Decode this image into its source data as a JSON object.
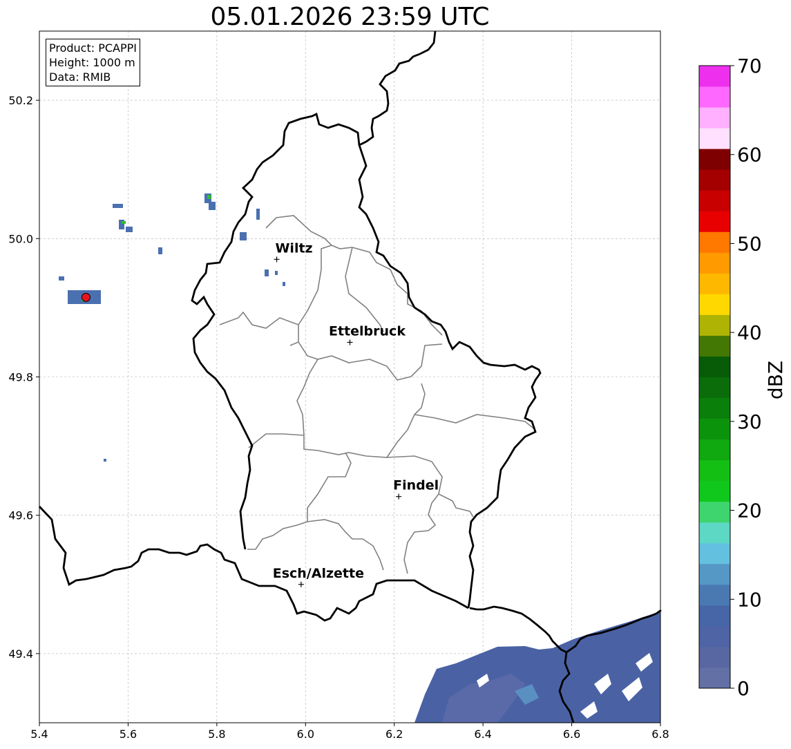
{
  "title": "05.01.2026 23:59 UTC",
  "info": {
    "product": "Product: PCAPPI",
    "height": "Height: 1000 m",
    "data": "Data: RMIB"
  },
  "axes": {
    "x_ticks": [
      "5.4",
      "5.6",
      "5.8",
      "6.0",
      "6.2",
      "6.4",
      "6.6",
      "6.8"
    ],
    "y_ticks": [
      "49.4",
      "49.6",
      "49.8",
      "50.0",
      "50.2"
    ],
    "xlim": [
      5.4,
      6.8
    ],
    "ylim": [
      49.3,
      50.3
    ],
    "grid": true
  },
  "cities": [
    {
      "name": "Wiltz",
      "lon": 5.935,
      "lat": 49.97
    },
    {
      "name": "Ettelbruck",
      "lon": 6.1,
      "lat": 49.85
    },
    {
      "name": "Findel",
      "lon": 6.21,
      "lat": 49.627
    },
    {
      "name": "Esch/Alzette",
      "lon": 5.99,
      "lat": 49.5
    }
  ],
  "radar_site": {
    "lon": 5.505,
    "lat": 49.915,
    "color": "#e8141c"
  },
  "colorbar": {
    "label": "dBZ",
    "ticks": [
      "0",
      "10",
      "20",
      "30",
      "40",
      "50",
      "60",
      "70"
    ],
    "min": 0,
    "max": 70,
    "colors": [
      "#6270a6",
      "#5867a2",
      "#4e64a5",
      "#4666a7",
      "#4a79b2",
      "#5598c6",
      "#64c0df",
      "#5cd8c4",
      "#3ed56e",
      "#10c81c",
      "#14bf14",
      "#10a910",
      "#0c930c",
      "#0a7f0a",
      "#0a6d0a",
      "#085c08",
      "#447805",
      "#aeb304",
      "#ffd800",
      "#ffb800",
      "#ff9a00",
      "#ff7800",
      "#e80000",
      "#c80000",
      "#a40000",
      "#7f0000",
      "#ffe0ff",
      "#ffb0ff",
      "#ff68ff",
      "#ee30ee"
    ]
  },
  "chart_data": {
    "type": "heatmap",
    "title": "05.01.2026 23:59 UTC",
    "xlabel": "",
    "ylabel": "",
    "xlim": [
      5.4,
      6.8
    ],
    "ylim": [
      49.3,
      50.3
    ],
    "colorbar_label": "dBZ",
    "colorbar_range": [
      0,
      70
    ],
    "grid": true
  }
}
